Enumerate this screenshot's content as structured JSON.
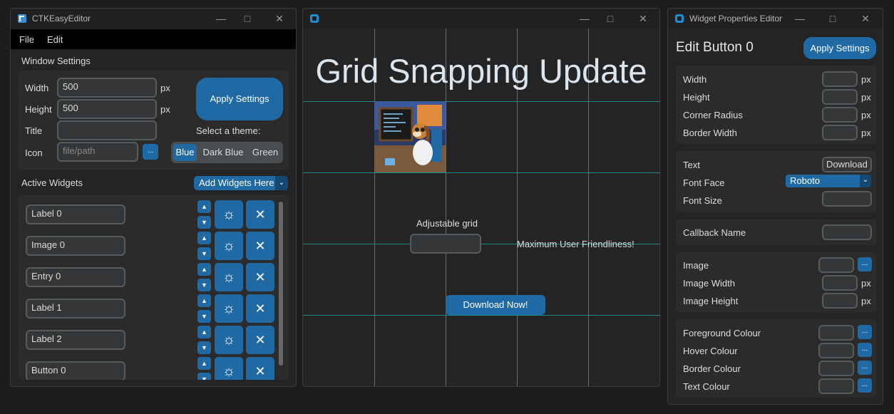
{
  "colors": {
    "accent": "#1f6aa5",
    "grid": "#1a8a8a"
  },
  "left": {
    "title": "CTKEasyEditor",
    "menu": [
      "File",
      "Edit"
    ],
    "window_settings_label": "Window Settings",
    "width_label": "Width",
    "width_value": "500",
    "height_label": "Height",
    "height_value": "500",
    "px": "px",
    "title_label": "Title",
    "title_value": "",
    "icon_label": "Icon",
    "icon_placeholder": "file/path",
    "browse": "...",
    "apply": "Apply Settings",
    "theme_label": "Select a theme:",
    "themes": [
      "Blue",
      "Dark Blue",
      "Green"
    ],
    "selected_theme": "Blue",
    "active_widgets_label": "Active Widgets",
    "add_widgets": "Add Widgets Here",
    "widgets": [
      "Label 0",
      "Image 0",
      "Entry 0",
      "Label 1",
      "Label 2",
      "Button 0"
    ]
  },
  "middle": {
    "heading": "Grid Snapping Update",
    "adjustable": "Adjustable grid",
    "friendliness": "Maximum User Friendliness!",
    "download": "Download Now!"
  },
  "right": {
    "title": "Widget Properties Editor",
    "heading": "Edit Button 0",
    "apply": "Apply Settings",
    "px": "px",
    "dims": [
      "Width",
      "Height",
      "Corner Radius",
      "Border Width"
    ],
    "text_label": "Text",
    "text_value": "Download",
    "font_face_label": "Font Face",
    "font_face_value": "Roboto",
    "font_size_label": "Font Size",
    "callback_label": "Callback Name",
    "image_label": "Image",
    "image_width_label": "Image Width",
    "image_height_label": "Image Height",
    "browse": "...",
    "colours": [
      "Foreground Colour",
      "Hover Colour",
      "Border Colour",
      "Text Colour"
    ]
  }
}
